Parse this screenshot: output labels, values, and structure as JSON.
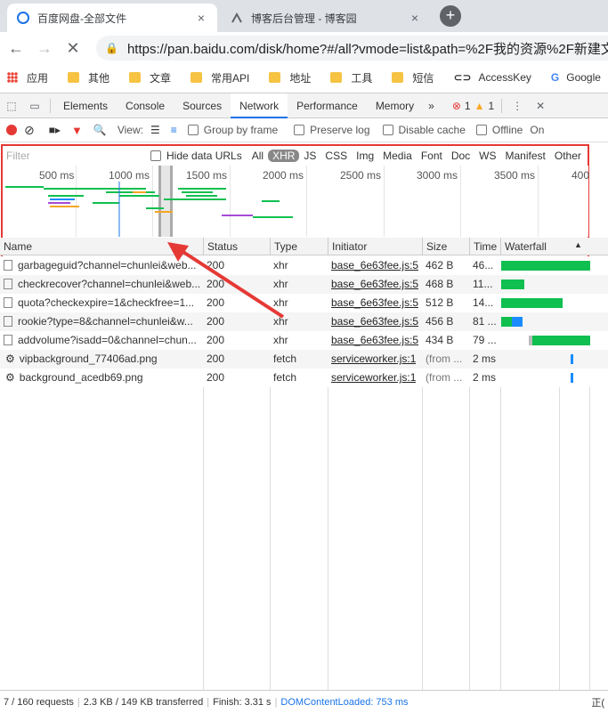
{
  "browser": {
    "tabs": [
      {
        "title": "百度网盘-全部文件",
        "close": "×"
      },
      {
        "title": "博客后台管理 - 博客园",
        "close": "×"
      }
    ],
    "newtab": "+",
    "url": "https://pan.baidu.com/disk/home?#/all?vmode=list&path=%2F我的资源%2F新建文"
  },
  "bookmarks": [
    {
      "label": "应用",
      "icon": "apps-grid-icon"
    },
    {
      "label": "其他",
      "icon": "folder-icon"
    },
    {
      "label": "文章",
      "icon": "folder-icon"
    },
    {
      "label": "常用API",
      "icon": "folder-icon"
    },
    {
      "label": "地址",
      "icon": "folder-icon"
    },
    {
      "label": "工具",
      "icon": "folder-icon"
    },
    {
      "label": "短信",
      "icon": "folder-icon"
    },
    {
      "label": "AccessKey",
      "icon": "accesskey-icon"
    },
    {
      "label": "Google",
      "icon": "google-icon"
    }
  ],
  "devtools": {
    "tabs": [
      "Elements",
      "Console",
      "Sources",
      "Network",
      "Performance",
      "Memory"
    ],
    "more": "»",
    "errors": "1",
    "warnings": "1",
    "toolbar": {
      "view_label": "View:",
      "group_by_frame": "Group by frame",
      "preserve_log": "Preserve log",
      "disable_cache": "Disable cache",
      "offline": "Offline",
      "online": "On"
    },
    "filter": {
      "placeholder": "Filter",
      "hide_data_urls": "Hide data URLs",
      "types": [
        "All",
        "XHR",
        "JS",
        "CSS",
        "Img",
        "Media",
        "Font",
        "Doc",
        "WS",
        "Manifest",
        "Other"
      ],
      "selected": "XHR"
    },
    "overview_ticks": [
      "500 ms",
      "1000 ms",
      "1500 ms",
      "2000 ms",
      "2500 ms",
      "3000 ms",
      "3500 ms",
      "400"
    ],
    "columns": [
      "Name",
      "Status",
      "Type",
      "Initiator",
      "Size",
      "Time",
      "Waterfall"
    ],
    "requests": [
      {
        "name": "garbageguid?channel=chunlei&web...",
        "status": "200",
        "type": "xhr",
        "initiator": "base_6e63fee.js:5",
        "size": "462 B",
        "time": "46...",
        "icon": "file-icon"
      },
      {
        "name": "checkrecover?channel=chunlei&web...",
        "status": "200",
        "type": "xhr",
        "initiator": "base_6e63fee.js:5",
        "size": "468 B",
        "time": "11...",
        "icon": "file-icon"
      },
      {
        "name": "quota?checkexpire=1&checkfree=1...",
        "status": "200",
        "type": "xhr",
        "initiator": "base_6e63fee.js:5",
        "size": "512 B",
        "time": "14...",
        "icon": "file-icon"
      },
      {
        "name": "rookie?type=8&channel=chunlei&w...",
        "status": "200",
        "type": "xhr",
        "initiator": "base_6e63fee.js:5",
        "size": "456 B",
        "time": "81 ...",
        "icon": "file-icon"
      },
      {
        "name": "addvolume?isadd=0&channel=chun...",
        "status": "200",
        "type": "xhr",
        "initiator": "base_6e63fee.js:5",
        "size": "434 B",
        "time": "79 ...",
        "icon": "file-icon"
      },
      {
        "name": "vipbackground_77406ad.png",
        "status": "200",
        "type": "fetch",
        "initiator": "serviceworker.js:1",
        "size": "(from ...",
        "time": "2 ms",
        "icon": "gear-icon"
      },
      {
        "name": "background_acedb69.png",
        "status": "200",
        "type": "fetch",
        "initiator": "serviceworker.js:1",
        "size": "(from ...",
        "time": "2 ms",
        "icon": "gear-icon"
      }
    ],
    "status": {
      "requests": "7 / 160 requests",
      "transferred": "2.3 KB / 149 KB transferred",
      "finish": "Finish: 3.31 s",
      "dcl": "DOMContentLoaded: 753 ms",
      "right": "正("
    }
  },
  "colors": {
    "accent": "#1a73e8",
    "highlight_box": "#e53935",
    "waterfall_green": "#0fbf4f",
    "waterfall_blue": "#1a8cff"
  }
}
